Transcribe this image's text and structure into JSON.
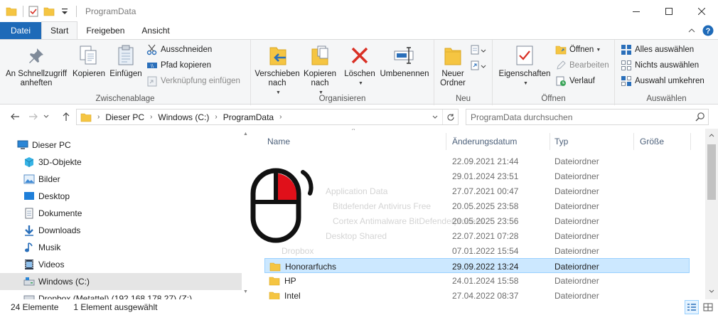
{
  "window": {
    "title": "ProgramData",
    "controls": [
      "minimize-icon",
      "maximize-icon",
      "close-icon"
    ]
  },
  "ribbon_tabs": [
    {
      "label": "Datei"
    },
    {
      "label": "Start"
    },
    {
      "label": "Freigeben"
    },
    {
      "label": "Ansicht"
    }
  ],
  "ribbon": {
    "clipboard": {
      "pin": "An Schnellzugriff anheften",
      "copy": "Kopieren",
      "paste": "Einfügen",
      "cut": "Ausschneiden",
      "copy_path": "Pfad kopieren",
      "paste_shortcut": "Verknüpfung einfügen",
      "label": "Zwischenablage"
    },
    "organize": {
      "move": "Verschieben nach",
      "copy_to": "Kopieren nach",
      "delete": "Löschen",
      "rename": "Umbenennen",
      "label": "Organisieren"
    },
    "new": {
      "new_folder": "Neuer Ordner",
      "label": "Neu"
    },
    "open": {
      "properties": "Eigenschaften",
      "open": "Öffnen",
      "edit": "Bearbeiten",
      "history": "Verlauf",
      "label": "Öffnen"
    },
    "select": {
      "select_all": "Alles auswählen",
      "select_none": "Nichts auswählen",
      "invert": "Auswahl umkehren",
      "label": "Auswählen"
    }
  },
  "address": {
    "crumbs": [
      "Dieser PC",
      "Windows (C:)",
      "ProgramData"
    ],
    "search_placeholder": "ProgramData durchsuchen"
  },
  "nav_pane": [
    {
      "label": "Dieser PC",
      "icon": "pc-icon"
    },
    {
      "label": "3D-Objekte",
      "icon": "3d-objects-icon"
    },
    {
      "label": "Bilder",
      "icon": "pictures-icon"
    },
    {
      "label": "Desktop",
      "icon": "desktop-icon"
    },
    {
      "label": "Dokumente",
      "icon": "documents-icon"
    },
    {
      "label": "Downloads",
      "icon": "downloads-icon"
    },
    {
      "label": "Musik",
      "icon": "music-icon"
    },
    {
      "label": "Videos",
      "icon": "videos-icon"
    },
    {
      "label": "Windows (C:)",
      "icon": "drive-icon"
    },
    {
      "label": "Dropbox (Metattel) (192.168.178.27) (Z:)",
      "icon": "network-drive-icon"
    }
  ],
  "columns": {
    "name": "Name",
    "date": "Änderungsdatum",
    "type": "Typ",
    "size": "Größe"
  },
  "files": [
    {
      "name": "",
      "date": "22.09.2021 21:44",
      "type": "Dateiordner"
    },
    {
      "name": "",
      "date": "29.01.2024 23:51",
      "type": "Dateiordner"
    },
    {
      "name": "Application Data",
      "date": "27.07.2021 00:47",
      "type": "Dateiordner"
    },
    {
      "name": "Bitdefender Antivirus Free",
      "date": "20.05.2025 23:58",
      "type": "Dateiordner"
    },
    {
      "name": "Cortex Antimalware BitDefenderprocess",
      "date": "20.05.2025 23:56",
      "type": "Dateiordner"
    },
    {
      "name": "Desktop Shared",
      "date": "22.07.2021 07:28",
      "type": "Dateiordner"
    },
    {
      "name": "Dropbox",
      "date": "07.01.2022 15:54",
      "type": "Dateiordner"
    },
    {
      "name": "Honorarfuchs",
      "date": "29.09.2022 13:24",
      "type": "Dateiordner"
    },
    {
      "name": "HP",
      "date": "24.01.2024 15:58",
      "type": "Dateiordner"
    },
    {
      "name": "Intel",
      "date": "27.04.2022 08:37",
      "type": "Dateiordner"
    }
  ],
  "status": {
    "count": "24 Elemente",
    "selection": "1 Element ausgewählt"
  },
  "colors": {
    "accent": "#1e6ab8",
    "selection": "#cce8ff",
    "folder": "#f5c542"
  }
}
